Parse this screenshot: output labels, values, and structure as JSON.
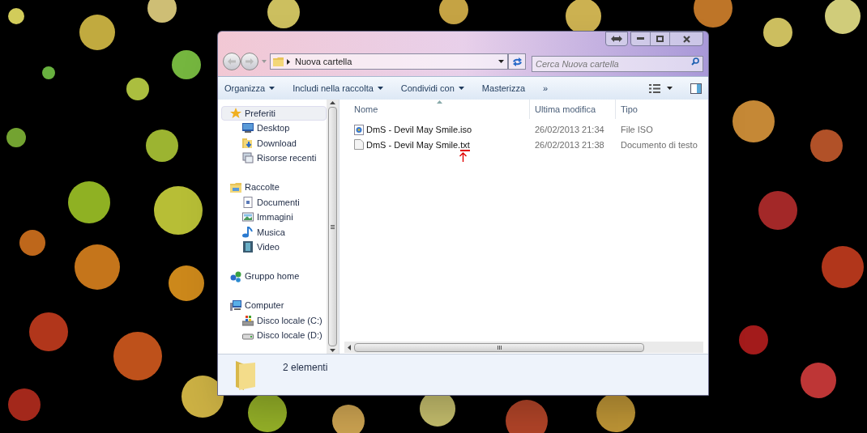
{
  "address_bar": {
    "path": "Nuova cartella",
    "search_placeholder": "Cerca Nuova cartella"
  },
  "toolbar": [
    {
      "label": "Organizza",
      "dropdown": true
    },
    {
      "label": "Includi nella raccolta",
      "dropdown": true
    },
    {
      "label": "Condividi con",
      "dropdown": true
    },
    {
      "label": "Masterizza",
      "dropdown": false
    },
    {
      "label": "»",
      "dropdown": false
    }
  ],
  "sidebar": [
    {
      "label": "Preferiti",
      "kind": "favorites",
      "selected": true,
      "children": [
        {
          "label": "Desktop",
          "kind": "desktop"
        },
        {
          "label": "Download",
          "kind": "download"
        },
        {
          "label": "Risorse recenti",
          "kind": "recent"
        }
      ]
    },
    {
      "label": "Raccolte",
      "kind": "libraries",
      "selected": false,
      "children": [
        {
          "label": "Documenti",
          "kind": "documents"
        },
        {
          "label": "Immagini",
          "kind": "pictures"
        },
        {
          "label": "Musica",
          "kind": "music"
        },
        {
          "label": "Video",
          "kind": "video"
        }
      ]
    },
    {
      "label": "Gruppo home",
      "kind": "homegroup",
      "selected": false
    },
    {
      "label": "Computer",
      "kind": "computer",
      "selected": false,
      "children": [
        {
          "label": "Disco locale (C:)",
          "kind": "system-drive"
        },
        {
          "label": "Disco locale (D:)",
          "kind": "drive"
        }
      ]
    }
  ],
  "table": {
    "columns": [
      "Nome",
      "Ultima modifica",
      "Tipo"
    ],
    "rows": [
      {
        "name": "DmS - Devil May Smile.iso",
        "kind": "disc-image",
        "modified": "26/02/2013 21:34",
        "type": "File ISO",
        "annotated": false
      },
      {
        "name": "DmS - Devil May Smile.txt",
        "kind": "text",
        "modified": "26/02/2013 21:38",
        "type": "Documento di testo",
        "annotated": true
      }
    ]
  },
  "status_bar": {
    "count": "2 elementi"
  }
}
